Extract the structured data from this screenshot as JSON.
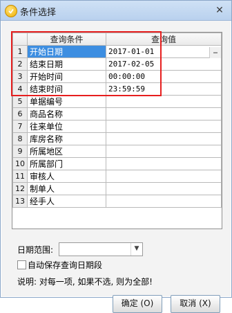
{
  "window": {
    "title": "条件选择"
  },
  "table": {
    "headers": [
      "查询条件",
      "查询值"
    ],
    "rows": [
      {
        "index": "1",
        "label": "开始日期",
        "value": "2017-01-01",
        "selected": true
      },
      {
        "index": "2",
        "label": "结束日期",
        "value": "2017-02-05"
      },
      {
        "index": "3",
        "label": "开始时间",
        "value": "00:00:00"
      },
      {
        "index": "4",
        "label": "结束时间",
        "value": "23:59:59"
      },
      {
        "index": "5",
        "label": "单据编号",
        "value": ""
      },
      {
        "index": "6",
        "label": "商品名称",
        "value": ""
      },
      {
        "index": "7",
        "label": "往来单位",
        "value": ""
      },
      {
        "index": "8",
        "label": "库房名称",
        "value": ""
      },
      {
        "index": "9",
        "label": "所属地区",
        "value": ""
      },
      {
        "index": "10",
        "label": "所属部门",
        "value": ""
      },
      {
        "index": "11",
        "label": "审核人",
        "value": ""
      },
      {
        "index": "12",
        "label": "制单人",
        "value": ""
      },
      {
        "index": "13",
        "label": "经手人",
        "value": ""
      }
    ]
  },
  "date_range": {
    "label": "日期范围:",
    "value": ""
  },
  "checkbox": {
    "label": "自动保存查询日期段",
    "checked": false
  },
  "note": "说明: 对每一项, 如果不选, 则为全部!",
  "buttons": {
    "ok": "确定 (O)",
    "cancel": "取消 (X)"
  }
}
